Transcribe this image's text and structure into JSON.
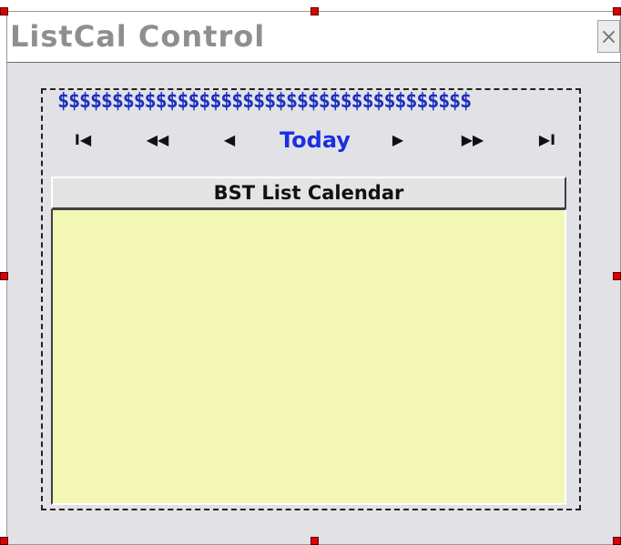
{
  "window": {
    "title": "ListCal Control",
    "close_label": "×"
  },
  "control": {
    "dollar_pattern": "$$$$$$$$$$$$$$$$$$$$$$$$$$$$$$$$$$$$$$",
    "nav": {
      "first_label": "I◀",
      "prev_page_label": "◀◀",
      "prev_label": "◀",
      "today_label": "Today",
      "next_label": "▶",
      "next_page_label": "▶▶",
      "last_label": "▶I"
    },
    "calendar_header": "BST List Calendar"
  },
  "colors": {
    "accent_blue": "#1c2fe0",
    "calendar_background": "#f3f7b5",
    "handle_red": "#dd0000"
  }
}
